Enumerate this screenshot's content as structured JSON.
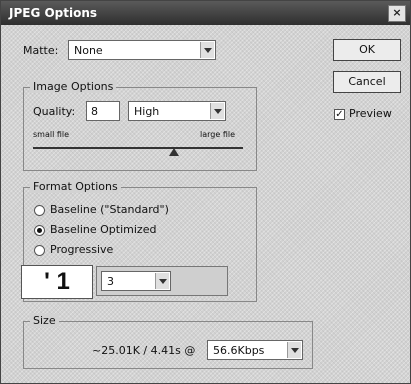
{
  "window": {
    "title": "JPEG Options",
    "close_glyph": "×"
  },
  "matte": {
    "label": "Matte:",
    "value": "None"
  },
  "buttons": {
    "ok": "OK",
    "cancel": "Cancel"
  },
  "preview": {
    "label": "Preview",
    "checked": true,
    "check_glyph": "✓"
  },
  "image_options": {
    "title": "Image Options",
    "quality_label": "Quality:",
    "quality_value": "8",
    "quality_preset": "High",
    "small_file_label": "small file",
    "large_file_label": "large file"
  },
  "format_options": {
    "title": "Format Options",
    "radios": [
      {
        "label": "Baseline (\"Standard\")",
        "selected": false
      },
      {
        "label": "Baseline Optimized",
        "selected": true
      },
      {
        "label": "Progressive",
        "selected": false
      }
    ],
    "overlay_text": "' 1",
    "scans_value": "3"
  },
  "size": {
    "title": "Size",
    "estimate": "~25.01K / 4.41s @",
    "speed": "56.6Kbps"
  }
}
